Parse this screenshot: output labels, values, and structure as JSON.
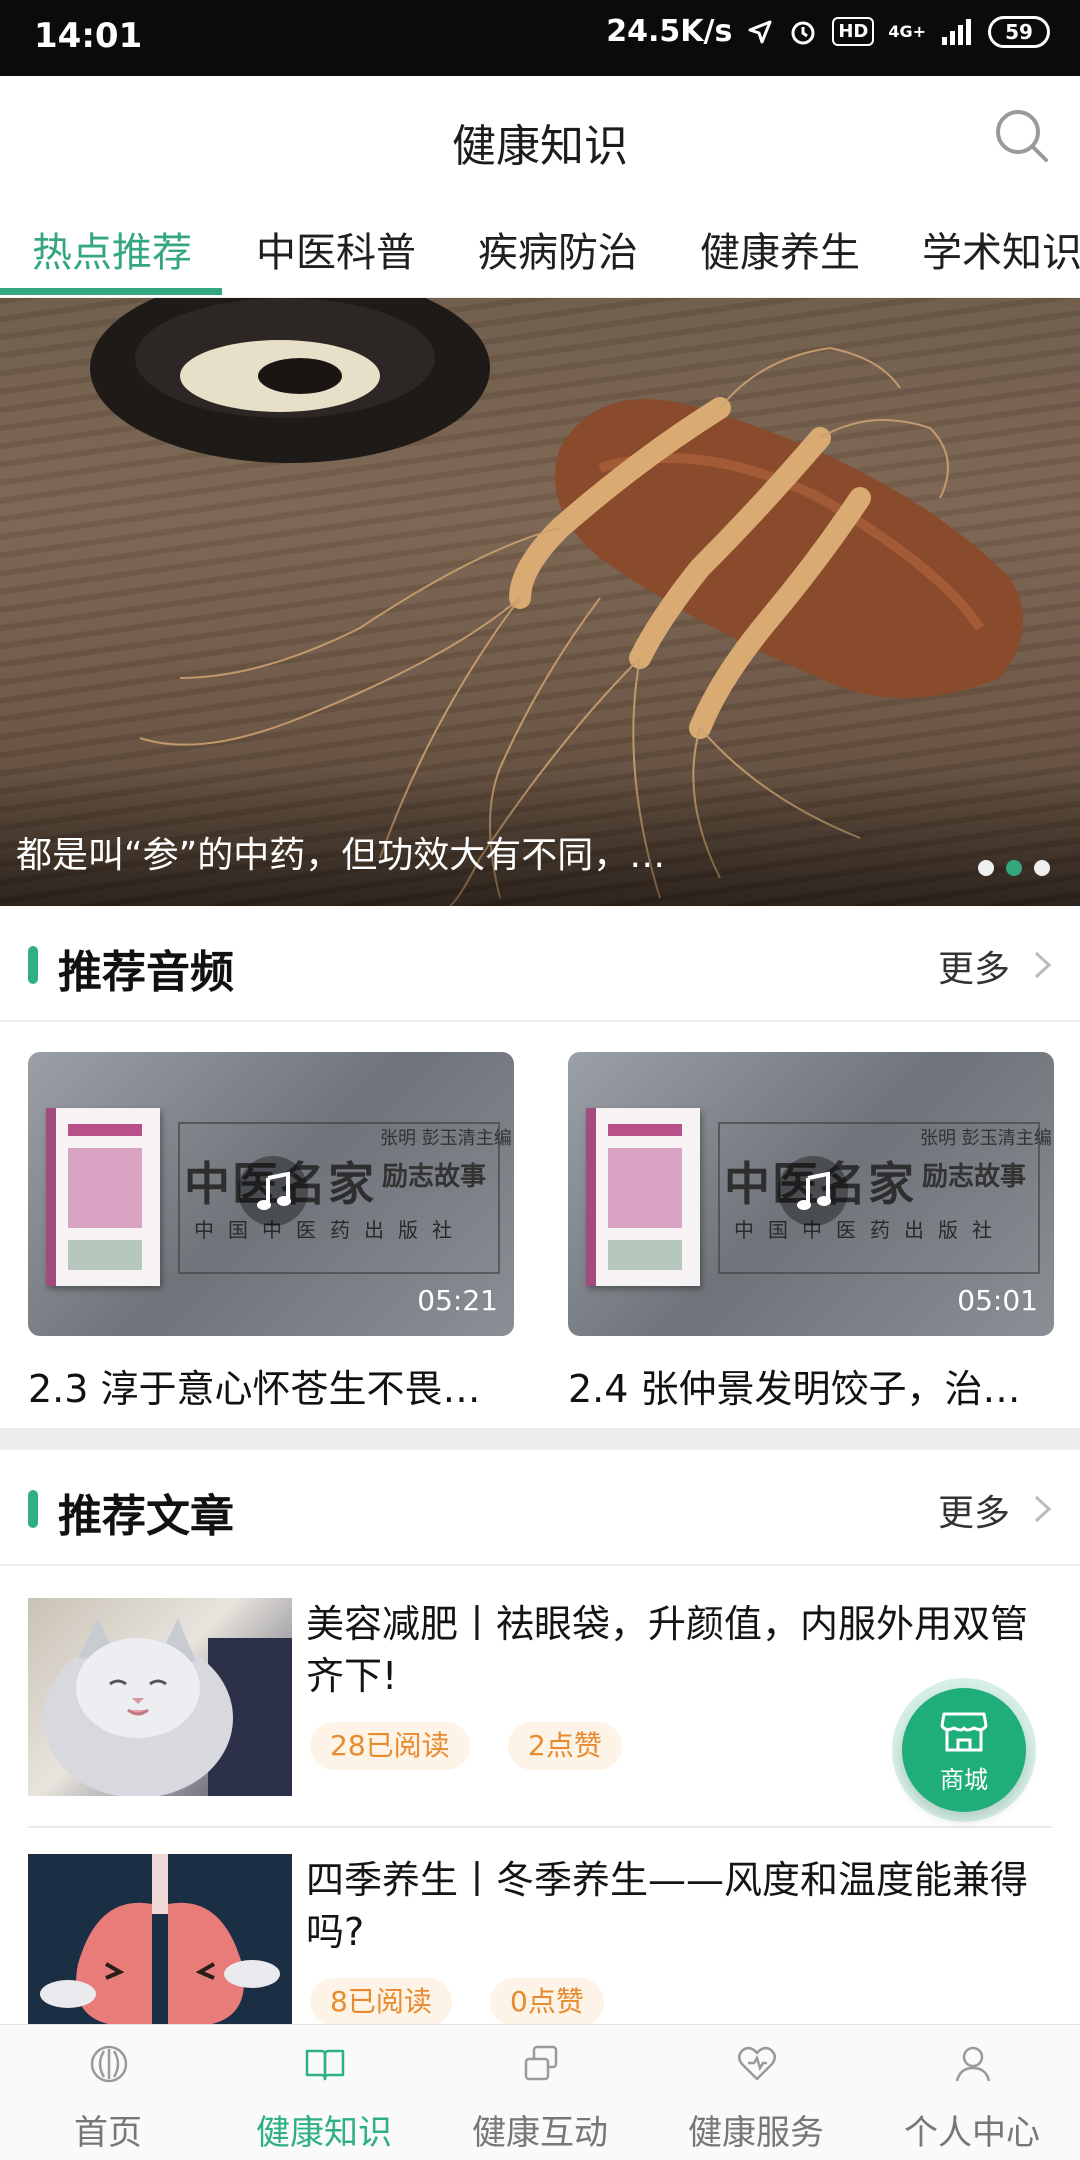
{
  "status_bar": {
    "time": "14:01",
    "network_speed": "24.5K/s",
    "hd_badge": "HD",
    "signal_label": "4G+",
    "battery": "59"
  },
  "header": {
    "title": "健康知识",
    "search_icon": "search-icon"
  },
  "tabs": [
    {
      "label": "热点推荐",
      "active": true
    },
    {
      "label": "中医科普",
      "active": false
    },
    {
      "label": "疾病防治",
      "active": false
    },
    {
      "label": "健康养生",
      "active": false
    },
    {
      "label": "学术知识",
      "active": false
    }
  ],
  "banner": {
    "caption": "都是叫“参”的中药，但功效大有不同，…",
    "dot_count": 3,
    "active_dot": 2
  },
  "audio_section": {
    "title": "推荐音频",
    "more_label": "更多",
    "cover_title": "中医名家",
    "cover_subtitle": "励志故事",
    "cover_editors": "张明 彭玉清主编",
    "cover_publisher": "中国中医药出版社",
    "items": [
      {
        "duration": "05:21",
        "title": "2.3 淳于意心怀苍生不畏…"
      },
      {
        "duration": "05:01",
        "title": "2.4 张仲景发明饺子，治…"
      }
    ]
  },
  "article_section": {
    "title": "推荐文章",
    "more_label": "更多",
    "items": [
      {
        "title": "美容减肥丨祛眼袋，升颜值，内服外用双管齐下!",
        "reads": "28已阅读",
        "likes": "2点赞"
      },
      {
        "title": "四季养生丨冬季养生——风度和温度能兼得吗?",
        "reads": "8已阅读",
        "likes": "0点赞"
      }
    ]
  },
  "floating_button": {
    "label": "商城",
    "icon": "shop-icon"
  },
  "bottom_nav": [
    {
      "label": "首页",
      "icon": "home-icon",
      "active": false
    },
    {
      "label": "健康知识",
      "icon": "book-icon",
      "active": true
    },
    {
      "label": "健康互动",
      "icon": "interaction-icon",
      "active": false
    },
    {
      "label": "健康服务",
      "icon": "service-heart-icon",
      "active": false
    },
    {
      "label": "个人中心",
      "icon": "user-icon",
      "active": false
    }
  ],
  "colors": {
    "accent": "#35a77f",
    "pill_text": "#e88b2e",
    "pill_bg": "#fdf3e7"
  }
}
